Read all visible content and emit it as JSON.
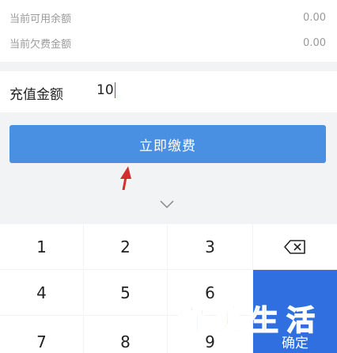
{
  "balance": {
    "available_label": "当前可用余额",
    "available_value": "0.00",
    "arrears_label": "当前欠费金额",
    "arrears_value": "0.00"
  },
  "recharge": {
    "label": "充值金额",
    "value": "10"
  },
  "pay_button": {
    "label": "立即缴费"
  },
  "keyboard": {
    "collapse_icon": "chevron-down-icon",
    "keys": [
      "1",
      "2",
      "3",
      "4",
      "5",
      "6",
      "7",
      "8",
      "9"
    ],
    "backspace_icon": "backspace-icon",
    "confirm_label": "确定"
  },
  "watermark": {
    "chars": [
      "宜",
      "美",
      "生",
      "活"
    ],
    "colors": [
      "#1e88e5",
      "#ff9800",
      "#43a047",
      "#00acc1"
    ]
  },
  "colors": {
    "accent": "#4a90e2",
    "confirm": "#2f6fe0",
    "annotation_arrow": "#d32f2f"
  }
}
